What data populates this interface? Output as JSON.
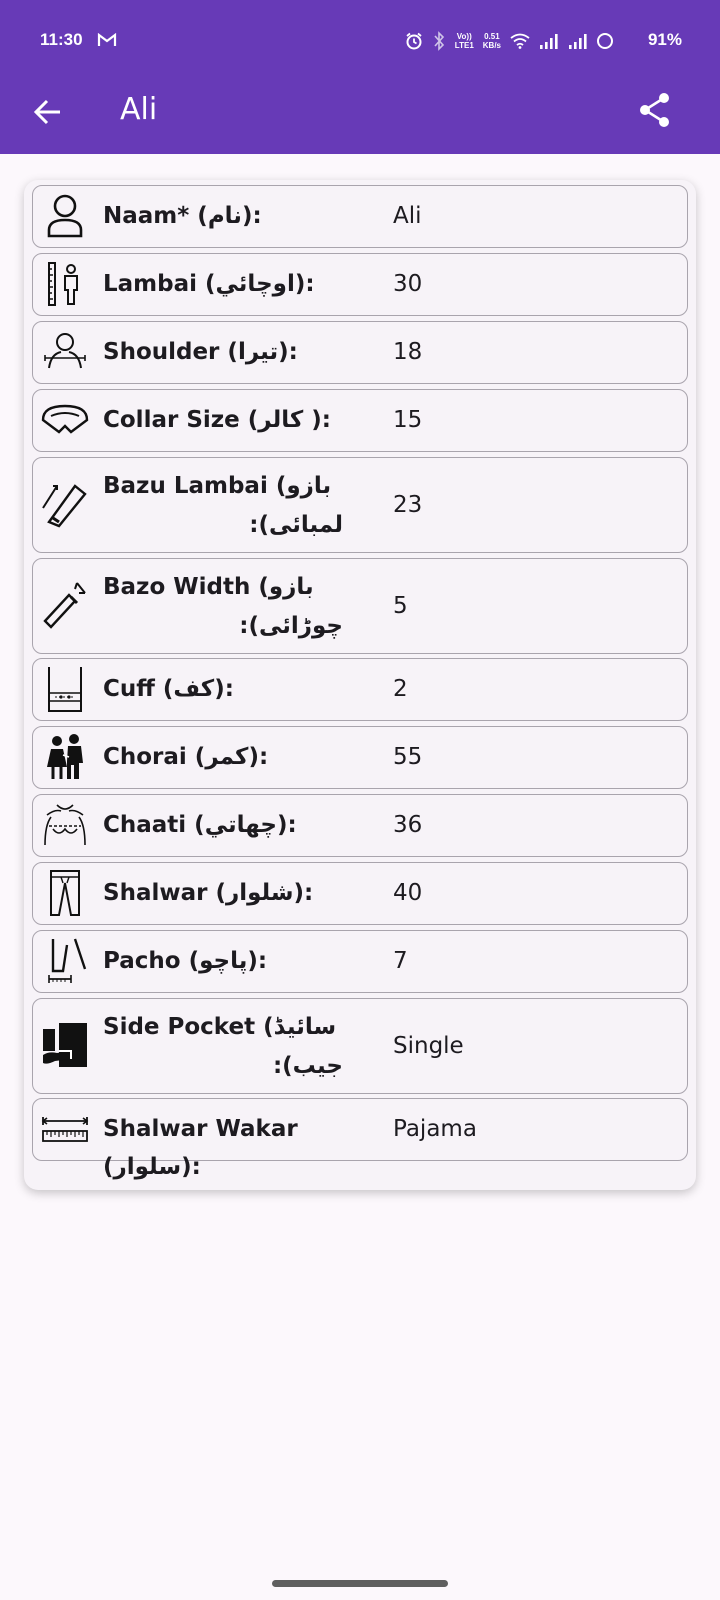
{
  "status_bar": {
    "time": "11:30",
    "network_top": "Vo))",
    "network_bottom": "LTE1",
    "speed_top": "0.51",
    "speed_bottom": "KB/s",
    "battery": "91%"
  },
  "app_bar": {
    "title": "Ali"
  },
  "fields": [
    {
      "label": "Naam* (نام):",
      "value": "Ali",
      "icon": "person-icon"
    },
    {
      "label": "Lambai (اوچائي):",
      "value": "30",
      "icon": "height-measure-icon"
    },
    {
      "label": "Shoulder (تیرا):",
      "value": "18",
      "icon": "shoulder-icon"
    },
    {
      "label": "Collar Size (کالر ):",
      "value": "15",
      "icon": "collar-icon"
    },
    {
      "label_line1": "Bazu Lambai (بازو",
      "label_line2": "لمبائی):",
      "value": "23",
      "icon": "sleeve-length-icon"
    },
    {
      "label_line1": "Bazo Width (بازو",
      "label_line2": "چوڑائی):",
      "value": "5",
      "icon": "sleeve-width-icon"
    },
    {
      "label": "Cuff (کف):",
      "value": "2",
      "icon": "cuff-icon"
    },
    {
      "label": "Chorai (کمر):",
      "value": "55",
      "icon": "waist-icon"
    },
    {
      "label": "Chaati (چھاتي):",
      "value": "36",
      "icon": "chest-icon"
    },
    {
      "label": "Shalwar (شلوار):",
      "value": "40",
      "icon": "trousers-icon"
    },
    {
      "label": "Pacho (پاچو):",
      "value": "7",
      "icon": "hem-width-icon"
    },
    {
      "label_line1": "Side Pocket (سائیڈ",
      "label_line2": "جیب):",
      "value": "Single",
      "icon": "side-pocket-icon"
    },
    {
      "label": "Shalwar Wakar (سلوار):",
      "value": "Pajama",
      "icon": "ruler-icon"
    }
  ]
}
